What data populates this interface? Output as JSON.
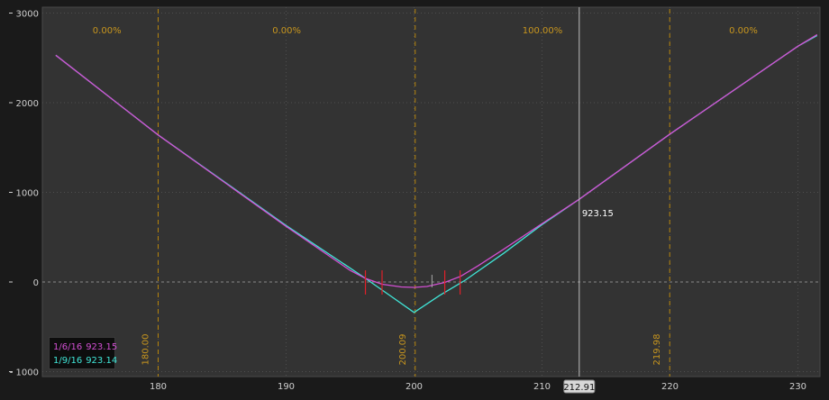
{
  "chart_data": {
    "type": "line",
    "xlim": [
      172,
      231.5
    ],
    "ylim": [
      -1000,
      3000
    ],
    "x_ticks": [
      180,
      190,
      200,
      210,
      220,
      230
    ],
    "y_ticks": [
      {
        "value": 3000,
        "label": "3000"
      },
      {
        "value": 2000,
        "label": "2000"
      },
      {
        "value": 1000,
        "label": "1000"
      },
      {
        "value": 0,
        "label": "0"
      },
      {
        "value": -1000,
        "label": "- 1000"
      }
    ],
    "grid": true,
    "zones": [
      {
        "from": 172,
        "to": 180,
        "label": "0.00%"
      },
      {
        "from": 180,
        "to": 200.09,
        "label": "0.00%"
      },
      {
        "from": 200.09,
        "to": 219.98,
        "label": "100.00%"
      },
      {
        "from": 219.98,
        "to": 231.5,
        "label": "0.00%"
      }
    ],
    "vlines": [
      {
        "x": 180.0,
        "label": "180.00"
      },
      {
        "x": 200.09,
        "label": "200.09"
      },
      {
        "x": 219.98,
        "label": "219.98"
      }
    ],
    "cursor": {
      "x": 212.91,
      "x_label": "212.91",
      "y_label": "923.15"
    },
    "markers": [
      196.2,
      197.5,
      202.4,
      203.6
    ],
    "series": [
      {
        "name": "1/6/16",
        "value_label": "923.15",
        "color": "#d24fd2",
        "x": [
          172,
          180,
          190,
          195,
          196.2,
          197.5,
          199,
          200,
          201,
          202.4,
          203.6,
          205,
          207,
          210,
          212.91,
          220,
          230,
          231.5
        ],
        "y": [
          2530,
          1640,
          620,
          130,
          40,
          -25,
          -55,
          -60,
          -50,
          -5,
          60,
          180,
          365,
          650,
          923,
          1650,
          2630,
          2760
        ]
      },
      {
        "name": "1/9/16",
        "value_label": "923.14",
        "color": "#40e6d8",
        "x": [
          172,
          180,
          190,
          196,
          198,
          200,
          202,
          204,
          207,
          210,
          212.91,
          220,
          230,
          231.5
        ],
        "y": [
          2530,
          1640,
          630,
          60,
          -140,
          -340,
          -150,
          20,
          320,
          640,
          923,
          1650,
          2630,
          2750
        ]
      }
    ]
  }
}
